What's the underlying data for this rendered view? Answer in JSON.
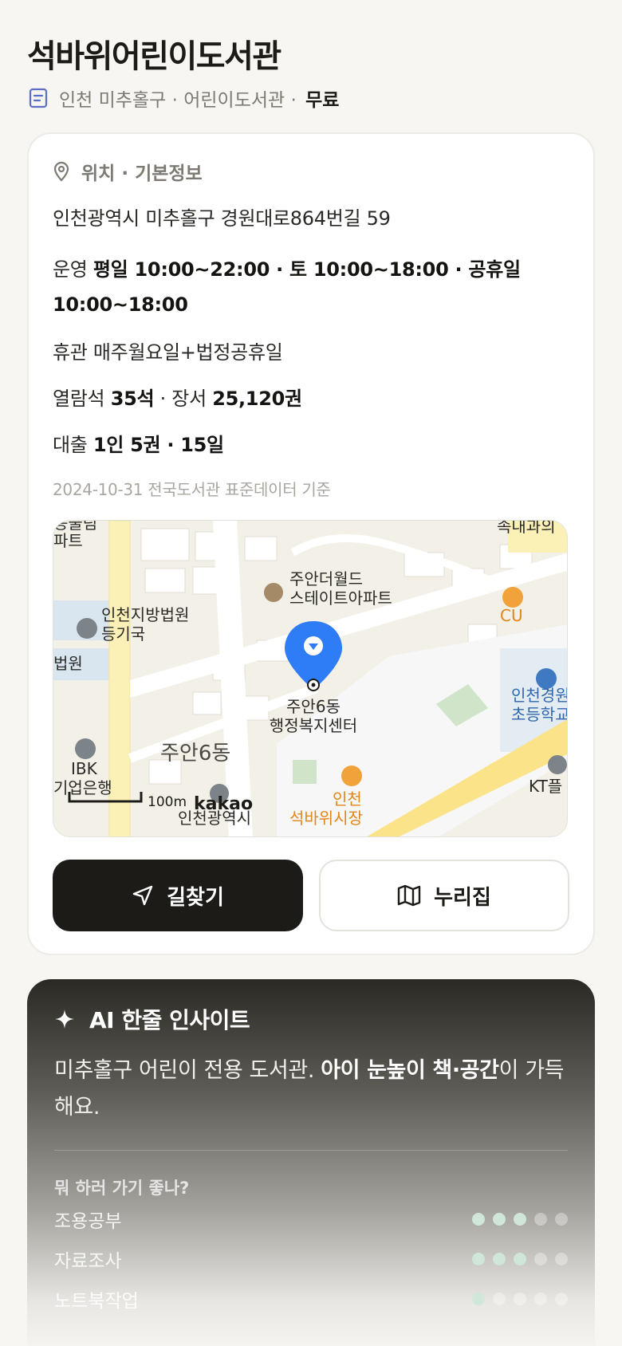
{
  "header": {
    "title": "석바위어린이도서관",
    "region": "인천 미추홀구",
    "type": "어린이도서관",
    "fee": "무료",
    "separator": "·"
  },
  "info": {
    "section_title": "위치 · 기본정보",
    "address": "인천광역시 미추홀구 경원대로864번길 59",
    "hours_label": "운영",
    "hours_value": "평일 10:00~22:00 · 토 10:00~18:00 · 공휴일 10:00~18:00",
    "closed_label": "휴관",
    "closed_value": "매주월요일+법정공휴일",
    "seats_label": "열람석",
    "seats_value": "35석",
    "books_sep": "· 장서",
    "books_value": "25,120권",
    "loan_label": "대출",
    "loan_value": "1인 5권 · 15일",
    "source": "2024-10-31 전국도서관 표준데이터 기준"
  },
  "map": {
    "pin_label_1": "주안6동",
    "pin_label_2": "행정복지센터",
    "pois": {
      "apt_1": "주안더월드",
      "apt_2": "스테이트아파트",
      "court_1": "인천지방법원",
      "court_2": "등기국",
      "court_edge": "법원",
      "top_left_1": "농물림",
      "top_left_2": "파트",
      "top_right": "속내과의",
      "cu": "CU",
      "school_1": "인천경원",
      "school_2": "초등학교",
      "ibk_1": "IBK",
      "ibk_2": "기업은행",
      "dong": "주안6동",
      "market_1": "인천",
      "market_2": "석바위시장",
      "kt": "KT플",
      "bottom": "인천광역시",
      "scale": "100m",
      "brand": "kakao"
    }
  },
  "buttons": {
    "directions": "길찾기",
    "nuri": "누리집"
  },
  "ai": {
    "title": "AI 한줄 인사이트",
    "text_plain": "미추홀구 어린이 전용 도서관. ",
    "text_bold": "아이 눈높이 책·공간",
    "text_tail": "이 가득해요.",
    "question": "뭐 하러 가기 좋나?",
    "activities": [
      {
        "label": "조용공부",
        "score": 3,
        "max": 5
      },
      {
        "label": "자료조사",
        "score": 3,
        "max": 5
      },
      {
        "label": "노트북작업",
        "score": 1,
        "max": 5
      }
    ]
  }
}
